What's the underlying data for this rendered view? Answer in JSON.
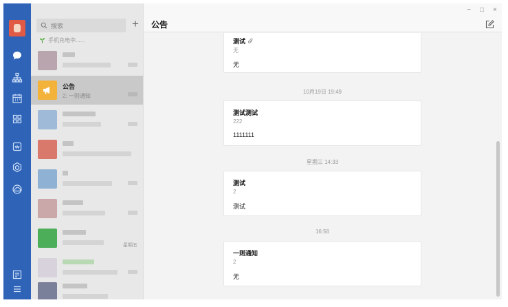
{
  "rail": {
    "icons": [
      "chat-icon",
      "org-chart-icon",
      "calendar-icon",
      "apps-icon",
      "mail-icon",
      "cube-icon",
      "cloud-icon",
      "notes-icon",
      "menu-icon"
    ]
  },
  "list": {
    "search_placeholder": "搜索",
    "add_symbol": "+",
    "hint": "手机充电中......",
    "active": {
      "name": "公告",
      "subtitle": "2: 一则通知"
    },
    "timestamp_label": "星期五"
  },
  "main": {
    "title": "公告",
    "window_controls": [
      "−",
      "□",
      "×"
    ],
    "cards": [
      {
        "title": "测试",
        "subtitle": "无",
        "body": "无",
        "has_attachment": true
      },
      {
        "title": "测试测试",
        "subtitle": "222",
        "body": "1111111"
      },
      {
        "title": "测试",
        "subtitle": "2",
        "body": "测试"
      },
      {
        "title": "一则通知",
        "subtitle": "2",
        "body": "无"
      }
    ],
    "timestamps": [
      "10月19日 19:49",
      "星期三 14:33",
      "16:56"
    ]
  },
  "colors": {
    "rail_bg": "#2e63b8",
    "notice_avatar": "#f3b33a",
    "list_bg": "#e8e8e8",
    "active_row": "#c9c9c9",
    "main_bg": "#f3f3f3"
  }
}
